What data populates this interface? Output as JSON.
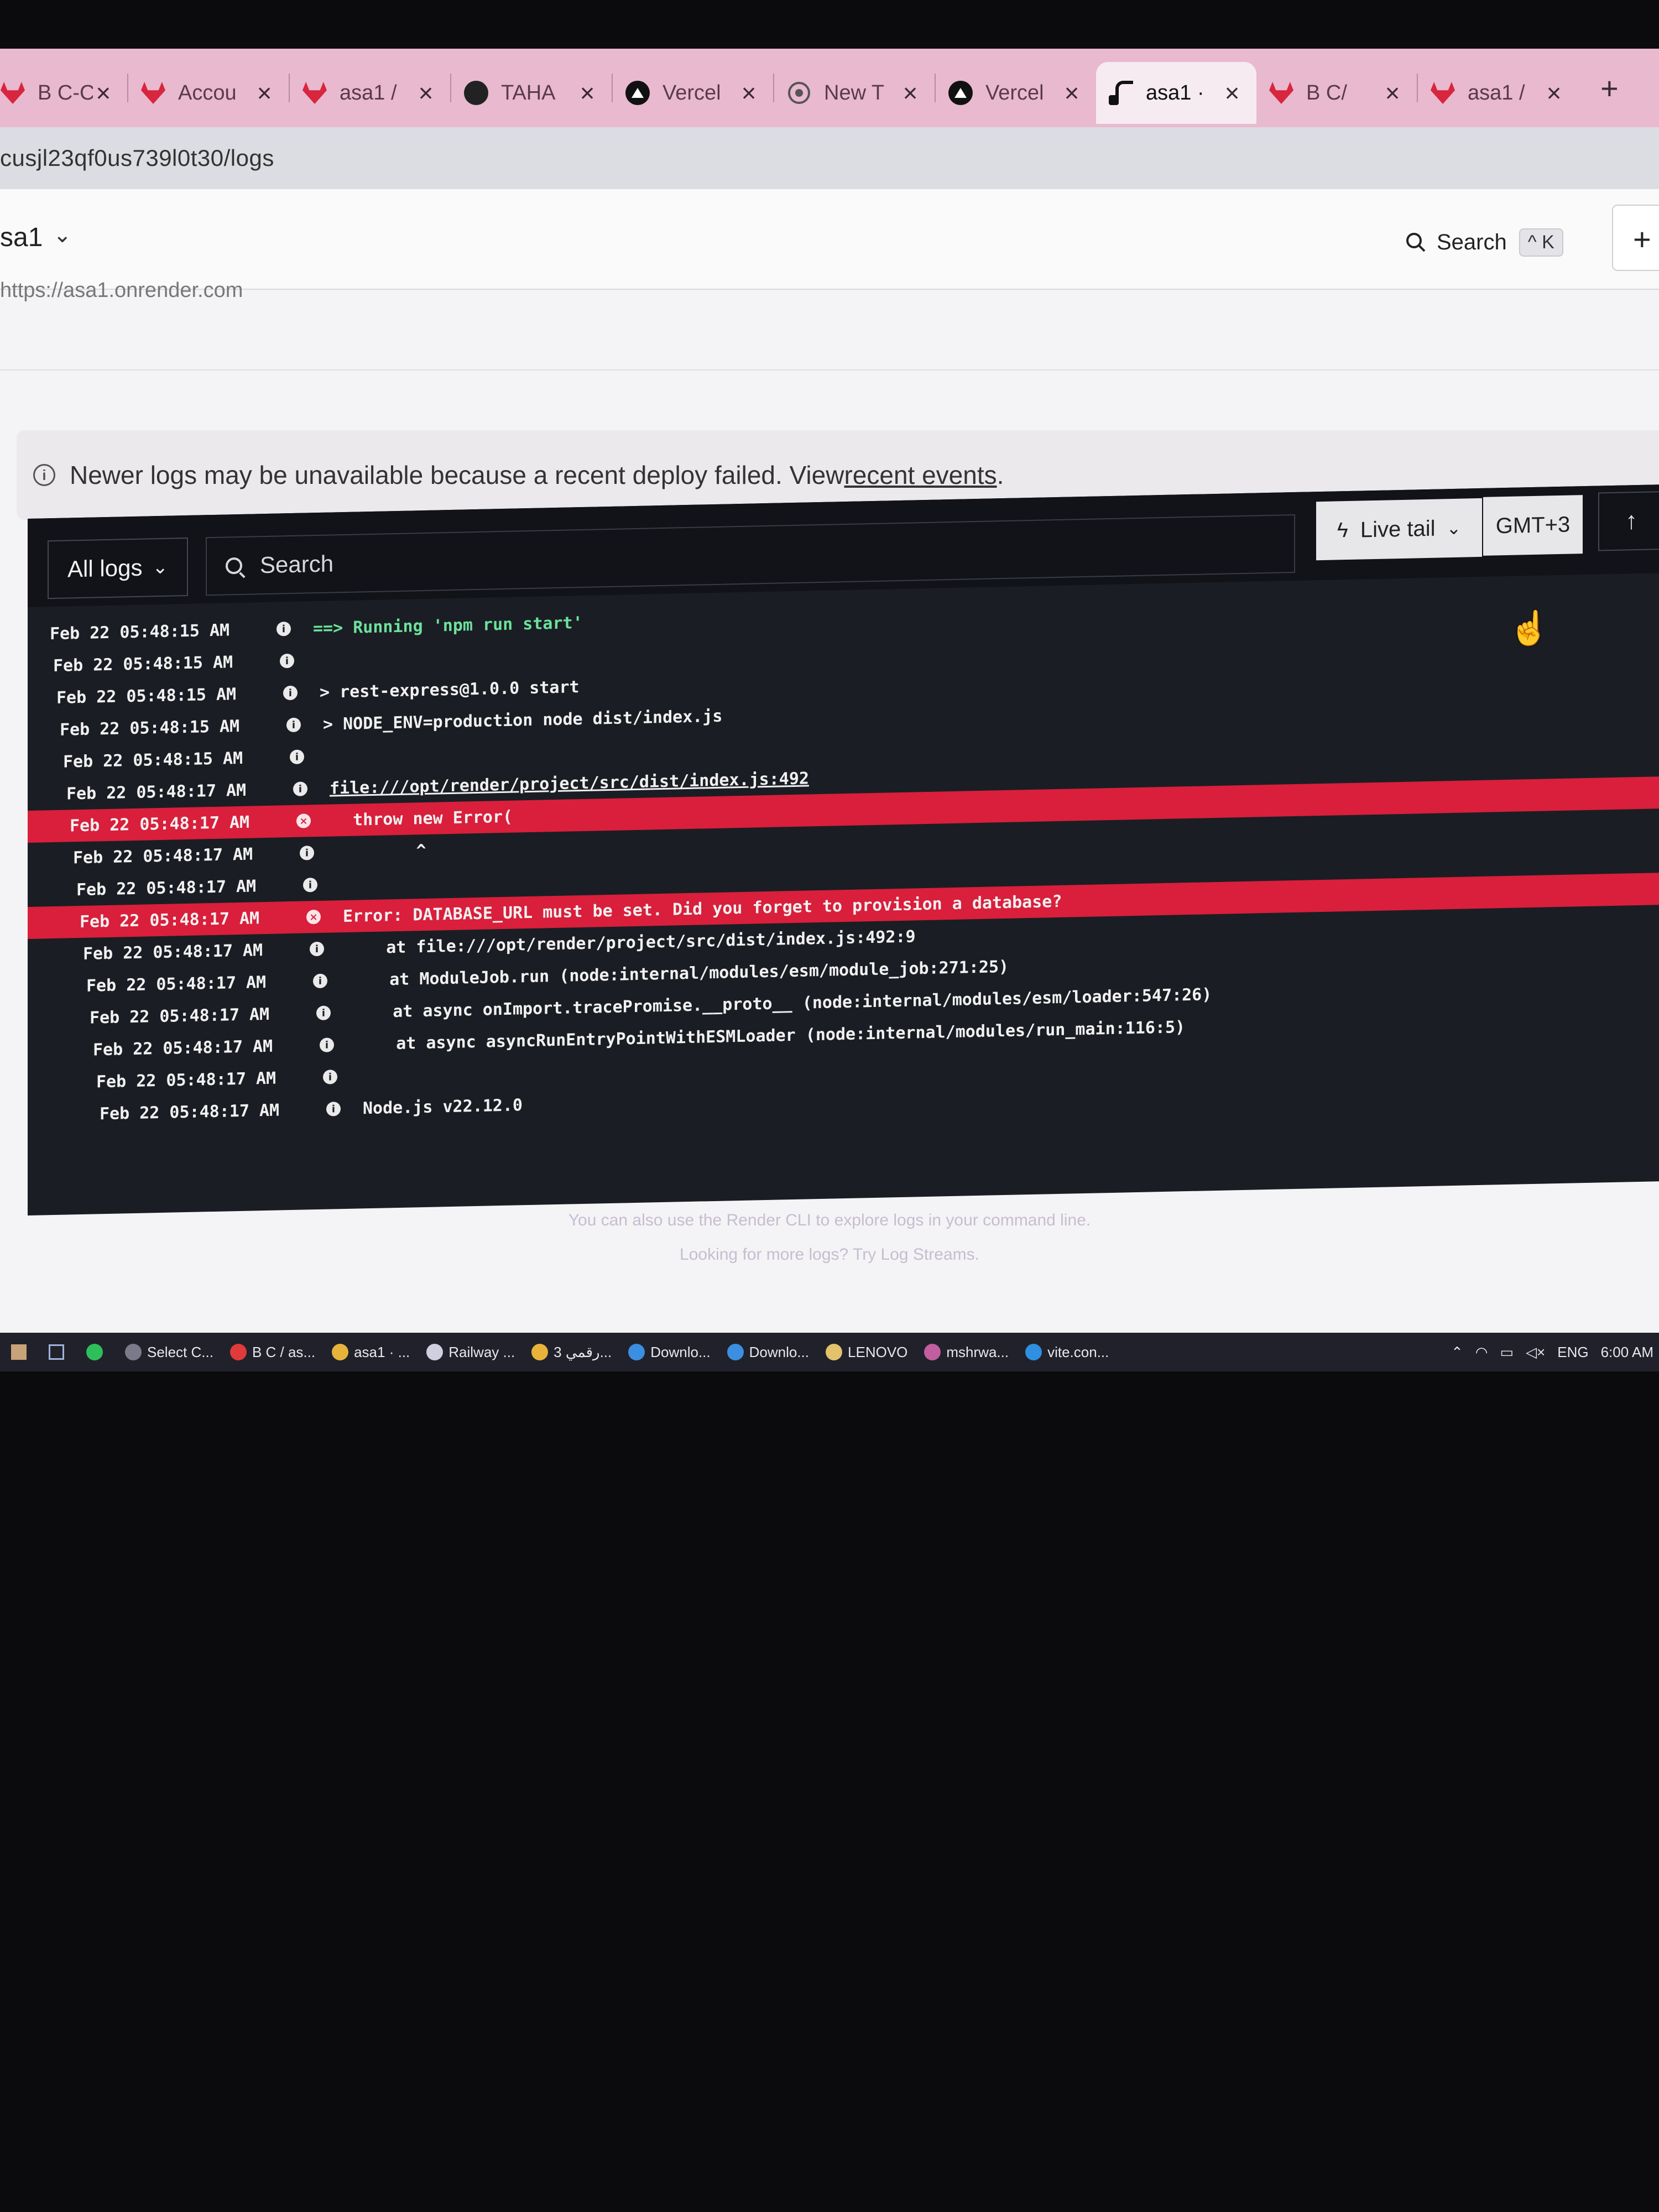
{
  "tabs": [
    {
      "label": "B C-C",
      "icon": "gitlab-icon"
    },
    {
      "label": "Accou",
      "icon": "gitlab-icon"
    },
    {
      "label": "asa1 /",
      "icon": "gitlab-icon"
    },
    {
      "label": "TAHA",
      "icon": "github-icon"
    },
    {
      "label": "Vercel",
      "icon": "vercel-icon"
    },
    {
      "label": "New T",
      "icon": "chrome-icon"
    },
    {
      "label": "Vercel",
      "icon": "vercel-icon"
    },
    {
      "label": "asa1 ·",
      "icon": "render-icon",
      "active": true
    },
    {
      "label": "B C/",
      "icon": "gitlab-icon"
    },
    {
      "label": "asa1 /",
      "icon": "gitlab-icon"
    }
  ],
  "address": {
    "url": "cusjl23qf0us739l0t30/logs"
  },
  "header": {
    "service_name": "sa1",
    "search_label": "Search",
    "search_shortcut": "^ K",
    "partial_url": "https://asa1.onrender.com"
  },
  "notice": {
    "text": "Newer logs may be unavailable because a recent deploy failed. View ",
    "link": "recent events",
    "suffix": "."
  },
  "logviewer": {
    "filter_label": "All logs",
    "search_placeholder": "Search",
    "live_tail_label": "Live tail",
    "timezone_label": "GMT+3"
  },
  "log_lines": [
    {
      "time": "Feb 22 05:48:15 AM",
      "level": "info",
      "message": "==> Running 'npm run start'",
      "style": "green"
    },
    {
      "time": "Feb 22 05:48:15 AM",
      "level": "info",
      "message": ""
    },
    {
      "time": "Feb 22 05:48:15 AM",
      "level": "info",
      "message": "> rest-express@1.0.0 start"
    },
    {
      "time": "Feb 22 05:48:15 AM",
      "level": "info",
      "message": "> NODE_ENV=production node dist/index.js"
    },
    {
      "time": "Feb 22 05:48:15 AM",
      "level": "info",
      "message": ""
    },
    {
      "time": "Feb 22 05:48:17 AM",
      "level": "info",
      "message": "file:///opt/render/project/src/dist/index.js:492",
      "style": "link"
    },
    {
      "time": "Feb 22 05:48:17 AM",
      "level": "error",
      "message": "  throw new Error("
    },
    {
      "time": "Feb 22 05:48:17 AM",
      "level": "info",
      "message": "        ^"
    },
    {
      "time": "Feb 22 05:48:17 AM",
      "level": "info",
      "message": ""
    },
    {
      "time": "Feb 22 05:48:17 AM",
      "level": "error",
      "message": "Error: DATABASE_URL must be set. Did you forget to provision a database?"
    },
    {
      "time": "Feb 22 05:48:17 AM",
      "level": "info",
      "message": "    at file:///opt/render/project/src/dist/index.js:492:9"
    },
    {
      "time": "Feb 22 05:48:17 AM",
      "level": "info",
      "message": "    at ModuleJob.run (node:internal/modules/esm/module_job:271:25)"
    },
    {
      "time": "Feb 22 05:48:17 AM",
      "level": "info",
      "message": "    at async onImport.tracePromise.__proto__ (node:internal/modules/esm/loader:547:26)"
    },
    {
      "time": "Feb 22 05:48:17 AM",
      "level": "info",
      "message": "    at async asyncRunEntryPointWithESMLoader (node:internal/modules/run_main:116:5)"
    },
    {
      "time": "Feb 22 05:48:17 AM",
      "level": "info",
      "message": ""
    },
    {
      "time": "Feb 22 05:48:17 AM",
      "level": "info",
      "message": "Node.js v22.12.0"
    }
  ],
  "hints": {
    "cli": "You can also use the Render CLI to explore logs in your command line.",
    "streams": "Looking for more logs? Try Log Streams."
  },
  "taskbar": {
    "items": [
      {
        "label": "Select C...",
        "icon": "terminal-icon"
      },
      {
        "label": "B C / as...",
        "icon": "opera-icon"
      },
      {
        "label": "asa1 · ...",
        "icon": "chrome-icon"
      },
      {
        "label": "Railway ...",
        "icon": "railway-icon"
      },
      {
        "label": "رقمي 3...",
        "icon": "chrome-icon"
      },
      {
        "label": "Downlo...",
        "icon": "download-icon"
      },
      {
        "label": "Downlo...",
        "icon": "download-icon"
      },
      {
        "label": "LENOVO",
        "icon": "folder-icon"
      },
      {
        "label": "mshrwa...",
        "icon": "app-icon"
      },
      {
        "label": "vite.con...",
        "icon": "vscode-icon"
      }
    ],
    "language": "ENG",
    "clock": "6:00 AM"
  },
  "colors": {
    "error_row": "#d91f3b",
    "tab_strip": "#e9b9cf",
    "log_bg": "#1b1d24"
  }
}
